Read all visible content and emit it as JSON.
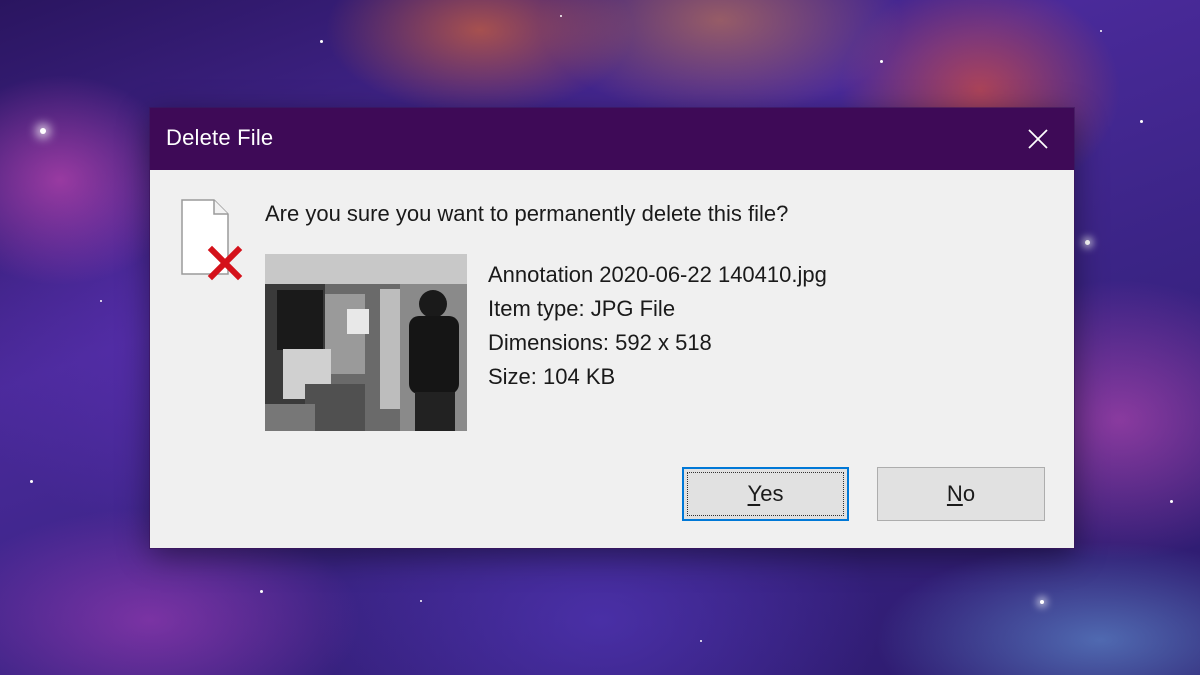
{
  "dialog": {
    "title": "Delete File",
    "question": "Are you sure you want to permanently delete this file?",
    "file": {
      "name": "Annotation 2020-06-22 140410.jpg",
      "item_type": "Item type: JPG File",
      "dimensions": "Dimensions: 592 x 518",
      "size": "Size: 104 KB"
    },
    "buttons": {
      "yes": {
        "accel": "Y",
        "rest": "es"
      },
      "no": {
        "accel": "N",
        "rest": "o"
      }
    }
  },
  "icons": {
    "close": "close-icon",
    "file": "file-icon",
    "delete_mark": "red-x-icon"
  },
  "colors": {
    "titlebar": "#3e0a57",
    "dialog_bg": "#f0f0f0",
    "focus_border": "#0078d7",
    "delete_mark": "#d4111a"
  }
}
